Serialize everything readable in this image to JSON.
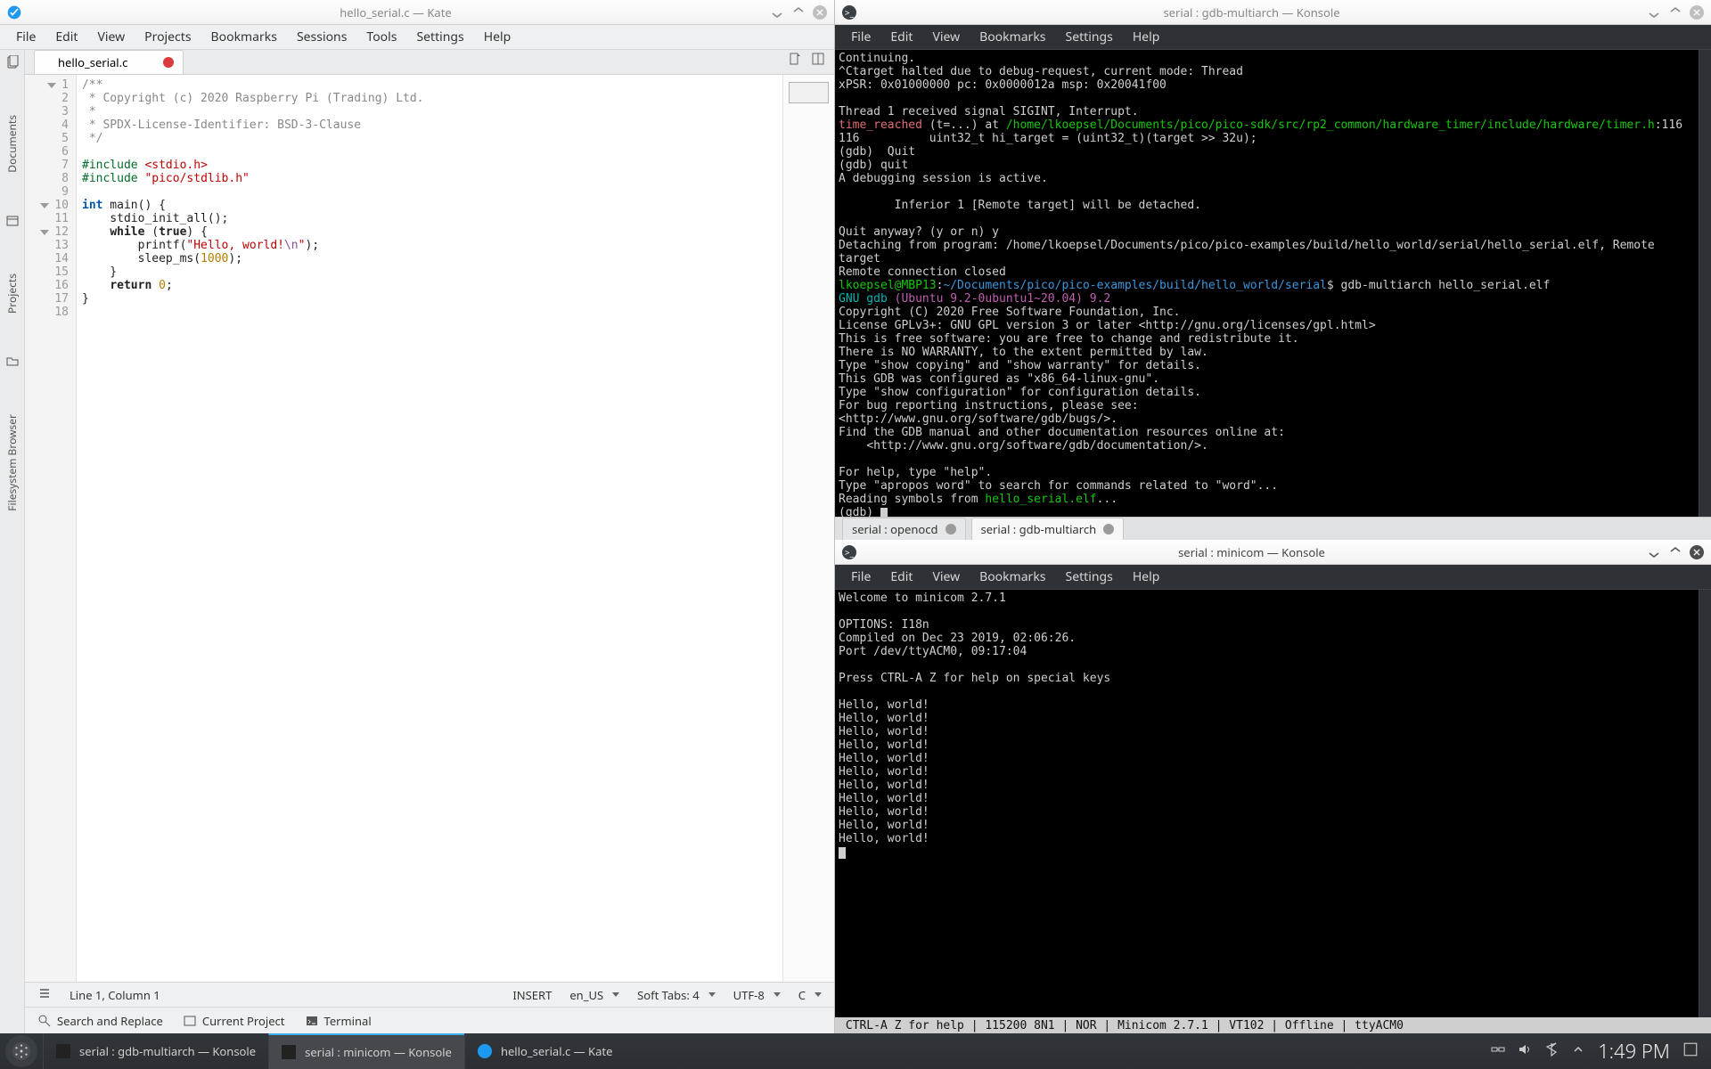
{
  "kate": {
    "title": "hello_serial.c — Kate",
    "menus": [
      "File",
      "Edit",
      "View",
      "Projects",
      "Bookmarks",
      "Sessions",
      "Tools",
      "Settings",
      "Help"
    ],
    "side_tools": [
      "Documents",
      "Projects",
      "Filesystem Browser"
    ],
    "tab_label": "hello_serial.c",
    "line_numbers": [
      "1",
      "2",
      "3",
      "4",
      "5",
      "6",
      "7",
      "8",
      "9",
      "10",
      "11",
      "12",
      "13",
      "14",
      "15",
      "16",
      "17",
      "18"
    ],
    "code": {
      "l1": "/**",
      "l2": " * Copyright (c) 2020 Raspberry Pi (Trading) Ltd.",
      "l3": " *",
      "l4": " * SPDX-License-Identifier: BSD-3-Clause",
      "l5": " */",
      "l6": "",
      "l7a": "#include ",
      "l7b": "<stdio.h>",
      "l8a": "#include ",
      "l8b": "\"pico/stdlib.h\"",
      "l9": "",
      "l10a": "int",
      "l10b": " main() {",
      "l11": "    stdio_init_all();",
      "l12a": "    ",
      "l12b": "while",
      "l12c": " (",
      "l12d": "true",
      "l12e": ") {",
      "l13a": "        printf(",
      "l13b": "\"Hello, world!",
      "l13c": "\\n",
      "l13d": "\"",
      "l13e": ");",
      "l14a": "        sleep_ms(",
      "l14b": "1000",
      "l14c": ");",
      "l15": "    }",
      "l16a": "    ",
      "l16b": "return",
      "l16c": " ",
      "l16d": "0",
      "l16e": ";",
      "l17": "}"
    },
    "status": {
      "cursor": "Line 1, Column 1",
      "mode": "INSERT",
      "locale": "en_US",
      "softtabs": "Soft Tabs: 4",
      "encoding": "UTF-8",
      "lang": "C"
    },
    "bottom": {
      "search": "Search and Replace",
      "project": "Current Project",
      "terminal": "Terminal"
    }
  },
  "konsole1": {
    "title": "serial : gdb-multiarch — Konsole",
    "menus": [
      "File",
      "Edit",
      "View",
      "Bookmarks",
      "Settings",
      "Help"
    ],
    "tabs": [
      "serial : openocd",
      "serial : gdb-multiarch"
    ],
    "lines": {
      "a": "Continuing.",
      "b": "^Ctarget halted due to debug-request, current mode: Thread",
      "c": "xPSR: 0x01000000 pc: 0x0000012a msp: 0x20041f00",
      "d": "",
      "e": "Thread 1 received signal SIGINT, Interrupt.",
      "f1": "time_reached",
      "f2": " (t=...) at ",
      "f3": "/home/lkoepsel/Documents/pico/pico-sdk/src/rp2_common/hardware_timer/include/hardware/timer.h",
      "f4": ":116",
      "g": "116          uint32_t hi_target = (uint32_t)(target >> 32u);",
      "h": "(gdb)  Quit",
      "i": "(gdb) quit",
      "j": "A debugging session is active.",
      "k": "",
      "l": "        Inferior 1 [Remote target] will be detached.",
      "m": "",
      "n": "Quit anyway? (y or n) y",
      "o": "Detaching from program: /home/lkoepsel/Documents/pico/pico-examples/build/hello_world/serial/hello_serial.elf, Remote target",
      "p": "Remote connection closed",
      "q1": "lkoepsel@MBP13",
      "q2": ":",
      "q3": "~/Documents/pico/pico-examples/build/hello_world/serial",
      "q4": "$",
      "q5": " gdb-multiarch hello_serial.elf",
      "r1": "GNU gdb ",
      "r2": "(Ubuntu 9.2-0ubuntu1~20.04) 9.2",
      "s": "Copyright (C) 2020 Free Software Foundation, Inc.",
      "t": "License GPLv3+: GNU GPL version 3 or later <http://gnu.org/licenses/gpl.html>",
      "u": "This is free software: you are free to change and redistribute it.",
      "v": "There is NO WARRANTY, to the extent permitted by law.",
      "w": "Type \"show copying\" and \"show warranty\" for details.",
      "x": "This GDB was configured as \"x86_64-linux-gnu\".",
      "y": "Type \"show configuration\" for configuration details.",
      "z": "For bug reporting instructions, please see:",
      "za": "<http://www.gnu.org/software/gdb/bugs/>.",
      "zb": "Find the GDB manual and other documentation resources online at:",
      "zc": "    <http://www.gnu.org/software/gdb/documentation/>.",
      "zd": "",
      "ze": "For help, type \"help\".",
      "zf": "Type \"apropos word\" to search for commands related to \"word\"...",
      "zg1": "Reading symbols from ",
      "zg2": "hello_serial.elf",
      "zg3": "...",
      "zh": "(gdb) "
    }
  },
  "konsole2": {
    "title": "serial : minicom — Konsole",
    "menus": [
      "File",
      "Edit",
      "View",
      "Bookmarks",
      "Settings",
      "Help"
    ],
    "lines": {
      "a": "Welcome to minicom 2.7.1",
      "b": "",
      "c": "OPTIONS: I18n",
      "d": "Compiled on Dec 23 2019, 02:06:26.",
      "e": "Port /dev/ttyACM0, 09:17:04",
      "f": "",
      "g": "Press CTRL-A Z for help on special keys",
      "h": "",
      "i": "Hello, world!",
      "j": "Hello, world!",
      "k": "Hello, world!",
      "l": "Hello, world!",
      "m": "Hello, world!",
      "n": "Hello, world!",
      "o": "Hello, world!",
      "p": "Hello, world!",
      "q": "Hello, world!",
      "r": "Hello, world!",
      "s": "Hello, world!"
    },
    "status": " CTRL-A Z for help | 115200 8N1 | NOR | Minicom 2.7.1 | VT102 | Offline | ttyACM0                                            "
  },
  "taskbar": {
    "items": [
      {
        "label": "serial : gdb-multiarch — Konsole"
      },
      {
        "label": "serial : minicom — Konsole"
      },
      {
        "label": "hello_serial.c — Kate"
      }
    ],
    "clock": "1:49 PM"
  }
}
